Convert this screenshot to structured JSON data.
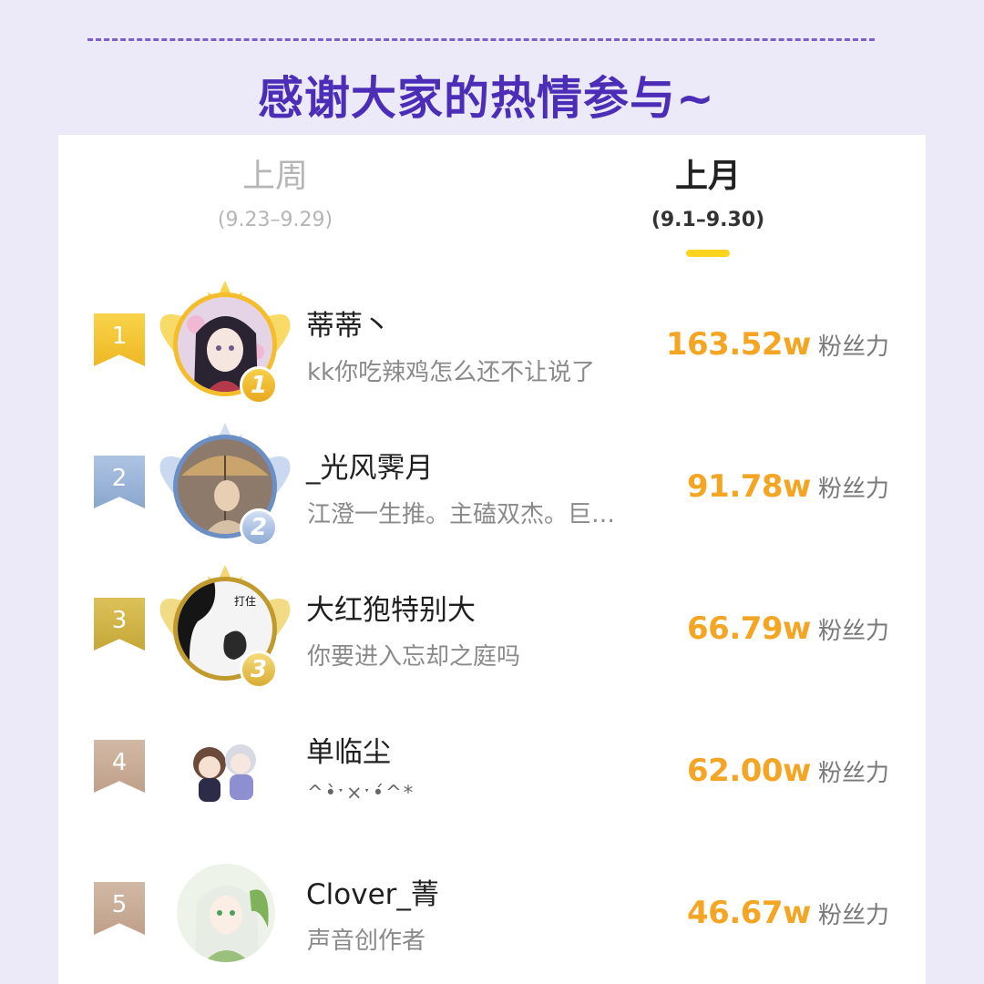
{
  "header": {
    "title": "感谢大家的热情参与~"
  },
  "tabs": [
    {
      "label": "上周",
      "range": "(9.23–9.29)",
      "active": false
    },
    {
      "label": "上月",
      "range": "(9.1–9.30)",
      "active": true
    }
  ],
  "colors": {
    "background": "#eceaf8",
    "headline": "#4b2db8",
    "score": "#f3a523",
    "tab_underline": "#ffd41f",
    "gold": "#f5c431",
    "silver": "#9db5d8",
    "bronze": "#d2b449",
    "rank4": "#c9ae98",
    "rank5": "#c9ae98"
  },
  "ranking": [
    {
      "rank": "1",
      "medal": "1",
      "name": "蒂蒂丶",
      "bio": "kk你吃辣鸡怎么还不让说了",
      "score": "163.52w",
      "unit": "粉丝力",
      "avatar_icon": "avatar-dark-hair-girl"
    },
    {
      "rank": "2",
      "medal": "2",
      "name": "_光风霁月",
      "bio": "江澄一生推。主磕双杰。巨…",
      "score": "91.78w",
      "unit": "粉丝力",
      "avatar_icon": "avatar-umbrella-figure"
    },
    {
      "rank": "3",
      "medal": "3",
      "name": "大红狍特别大",
      "bio": "你要进入忘却之庭吗",
      "score": "66.79w",
      "unit": "粉丝力",
      "avatar_icon": "avatar-ink-cat",
      "avatar_text": "打住"
    },
    {
      "rank": "4",
      "name": "单临尘",
      "bio": "^•̀ˑ×ˑ•́^*",
      "score": "62.00w",
      "unit": "粉丝力",
      "avatar_icon": "avatar-chibi-duo"
    },
    {
      "rank": "5",
      "name": "Clover_菁",
      "bio": "声音创作者",
      "score": "46.67w",
      "unit": "粉丝力",
      "avatar_icon": "avatar-green-hair-girl"
    }
  ]
}
